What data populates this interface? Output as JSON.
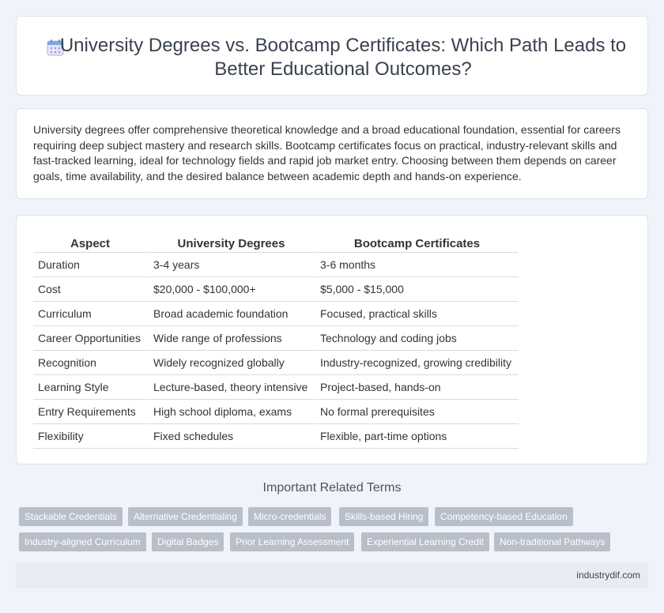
{
  "header": {
    "title": "University Degrees vs. Bootcamp Certificates: Which Path Leads to Better Educational Outcomes?",
    "icon": "calendar-icon"
  },
  "intro": {
    "text": "University degrees offer comprehensive theoretical knowledge and a broad educational foundation, essential for careers requiring deep subject mastery and research skills. Bootcamp certificates focus on practical, industry-relevant skills and fast-tracked learning, ideal for technology fields and rapid job market entry. Choosing between them depends on career goals, time availability, and the desired balance between academic depth and hands-on experience."
  },
  "table": {
    "headers": [
      "Aspect",
      "University Degrees",
      "Bootcamp Certificates"
    ],
    "rows": [
      [
        "Duration",
        "3-4 years",
        "3-6 months"
      ],
      [
        "Cost",
        "$20,000 - $100,000+",
        "$5,000 - $15,000"
      ],
      [
        "Curriculum",
        "Broad academic foundation",
        "Focused, practical skills"
      ],
      [
        "Career Opportunities",
        "Wide range of professions",
        "Technology and coding jobs"
      ],
      [
        "Recognition",
        "Widely recognized globally",
        "Industry-recognized, growing credibility"
      ],
      [
        "Learning Style",
        "Lecture-based, theory intensive",
        "Project-based, hands-on"
      ],
      [
        "Entry Requirements",
        "High school diploma, exams",
        "No formal prerequisites"
      ],
      [
        "Flexibility",
        "Fixed schedules",
        "Flexible, part-time options"
      ]
    ]
  },
  "terms": {
    "heading": "Important Related Terms",
    "items": [
      "Stackable Credentials",
      "Alternative Credentialing",
      "Micro-credentials",
      "Skills-based Hiring",
      "Competency-based Education",
      "Industry-aligned Curriculum",
      "Digital Badges",
      "Prior Learning Assessment",
      "Experiential Learning Credit",
      "Non-traditional Pathways"
    ]
  },
  "footer": {
    "site": "industrydif.com"
  },
  "colors": {
    "background": "#f0f3f9",
    "tag": "#b8bfca",
    "footer": "#e6ebf4"
  }
}
